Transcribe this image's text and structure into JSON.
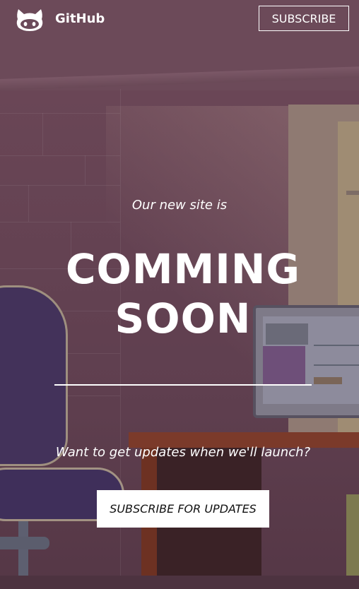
{
  "brand": {
    "name": "GitHub",
    "logo_icon": "github-octocat-icon"
  },
  "header": {
    "subscribe_label": "SUBSCRIBE"
  },
  "hero": {
    "intro": "Our new site is",
    "headline_line1": "COMMING",
    "headline_line2": "SOON",
    "updates_prompt": "Want to get updates when we'll launch?",
    "cta_label": "SUBSCRIBE FOR UPDATES"
  },
  "colors": {
    "text": "#ffffff",
    "overlay": "#634251",
    "cta_bg": "#ffffff",
    "cta_text": "#111111"
  }
}
